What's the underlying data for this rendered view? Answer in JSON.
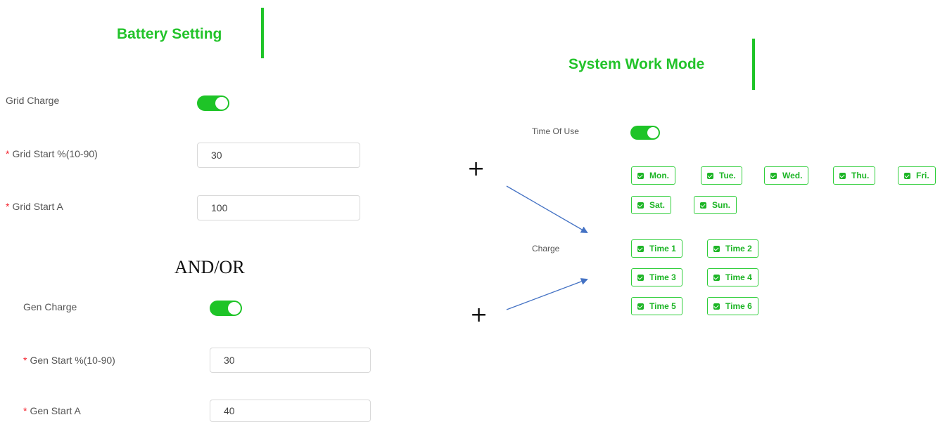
{
  "battery": {
    "title": "Battery Setting",
    "grid_charge_label": "Grid Charge",
    "grid_start_percent_label": "Grid Start %(10-90)",
    "grid_start_percent_value": "30",
    "grid_start_a_label": "Grid Start A",
    "grid_start_a_value": "100",
    "gen_charge_label": "Gen Charge",
    "gen_start_percent_label": "Gen Start %(10-90)",
    "gen_start_percent_value": "30",
    "gen_start_a_label": "Gen Start A",
    "gen_start_a_value": "40",
    "required_mark": "*",
    "grid_charge_enabled": true,
    "gen_charge_enabled": true
  },
  "connector": {
    "and_or": "AND/OR",
    "plus": "+"
  },
  "work_mode": {
    "title": "System Work Mode",
    "time_of_use_label": "Time Of Use",
    "time_of_use_enabled": true,
    "days": [
      "Mon.",
      "Tue.",
      "Wed.",
      "Thu.",
      "Fri.",
      "Sat.",
      "Sun."
    ],
    "charge_label": "Charge",
    "times": [
      "Time 1",
      "Time 2",
      "Time 3",
      "Time 4",
      "Time 5",
      "Time 6"
    ]
  },
  "colors": {
    "accent": "#1ec427",
    "arrow": "#4472c4",
    "required": "#f5222d"
  }
}
